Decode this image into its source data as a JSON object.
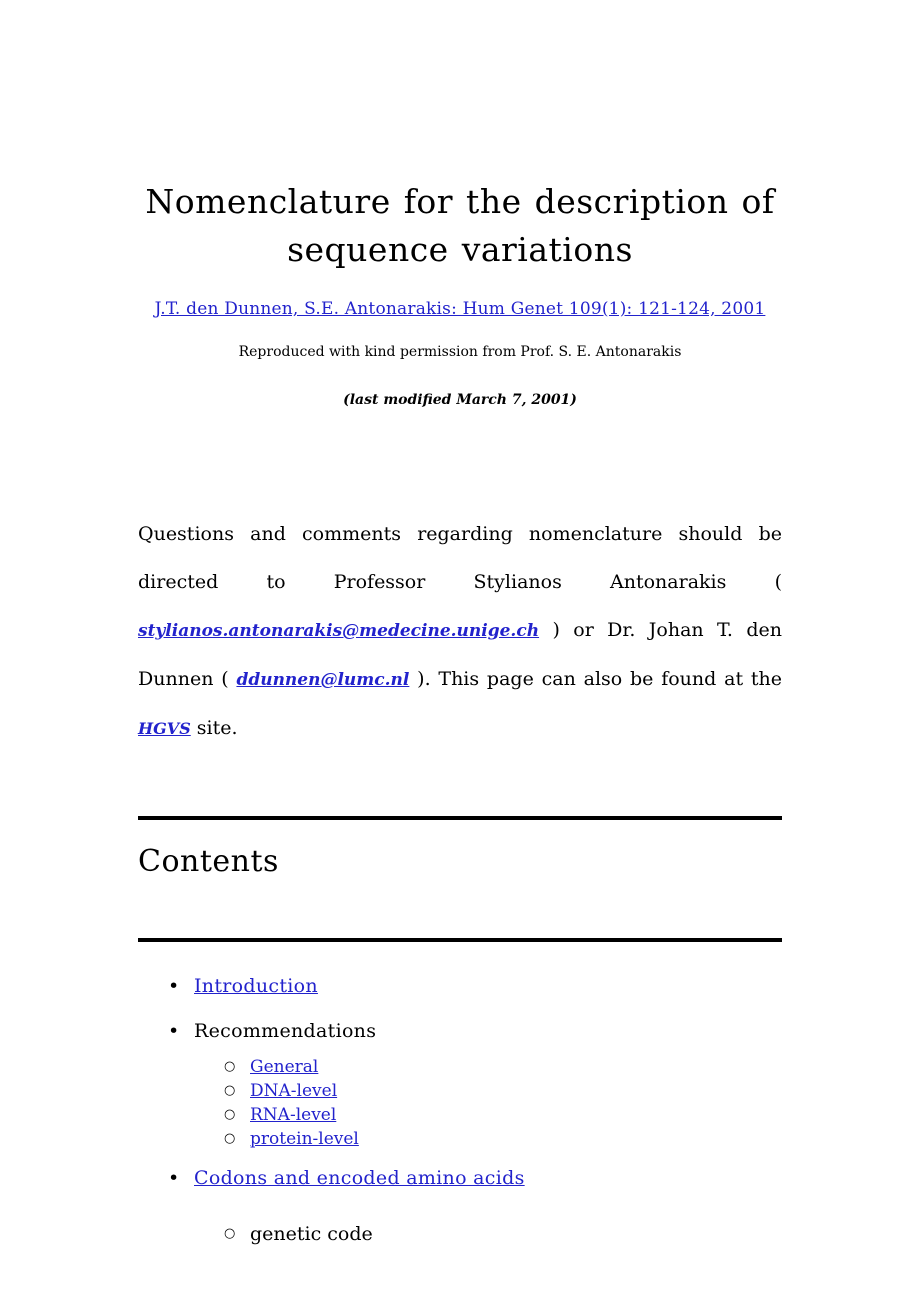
{
  "document": {
    "title": "Nomenclature for the description of sequence variations",
    "citation": "J.T. den Dunnen, S.E. Antonarakis: Hum Genet 109(1): 121-124, 2001",
    "credit": "Reproduced with kind permission from Prof. S. E. Antonarakis",
    "last_modified": "(last modified March 7, 2001)"
  },
  "intro": {
    "text_part_1": "Questions and comments regarding nomenclature should be directed to Professor Stylianos Antonarakis (",
    "email_antonarakis": "stylianos.antonarakis@medecine.unige.ch",
    "text_part_2": ") or Dr. Johan T. den Dunnen (",
    "email_dunnen": "ddunnen@lumc.nl",
    "text_part_3": "). This page can also be found at the",
    "site_link": "HGVS",
    "text_part_4": "site."
  },
  "contents": {
    "heading": "Contents",
    "bullet_disc": "•",
    "bullet_circle": "○",
    "items": [
      {
        "label": "Introduction",
        "is_link": true
      },
      {
        "label": "Recommendations",
        "is_link": false
      },
      {
        "label": "General",
        "is_link": true
      },
      {
        "label": "DNA-level",
        "is_link": true
      },
      {
        "label": "RNA-level",
        "is_link": true
      },
      {
        "label": "protein-level",
        "is_link": true
      },
      {
        "label": "Codons and encoded amino acids",
        "is_link": true
      },
      {
        "label": "genetic code",
        "is_link": false
      }
    ]
  },
  "colors": {
    "link": "#2222cc",
    "text": "#000000",
    "background": "#ffffff",
    "rule": "#000000"
  }
}
